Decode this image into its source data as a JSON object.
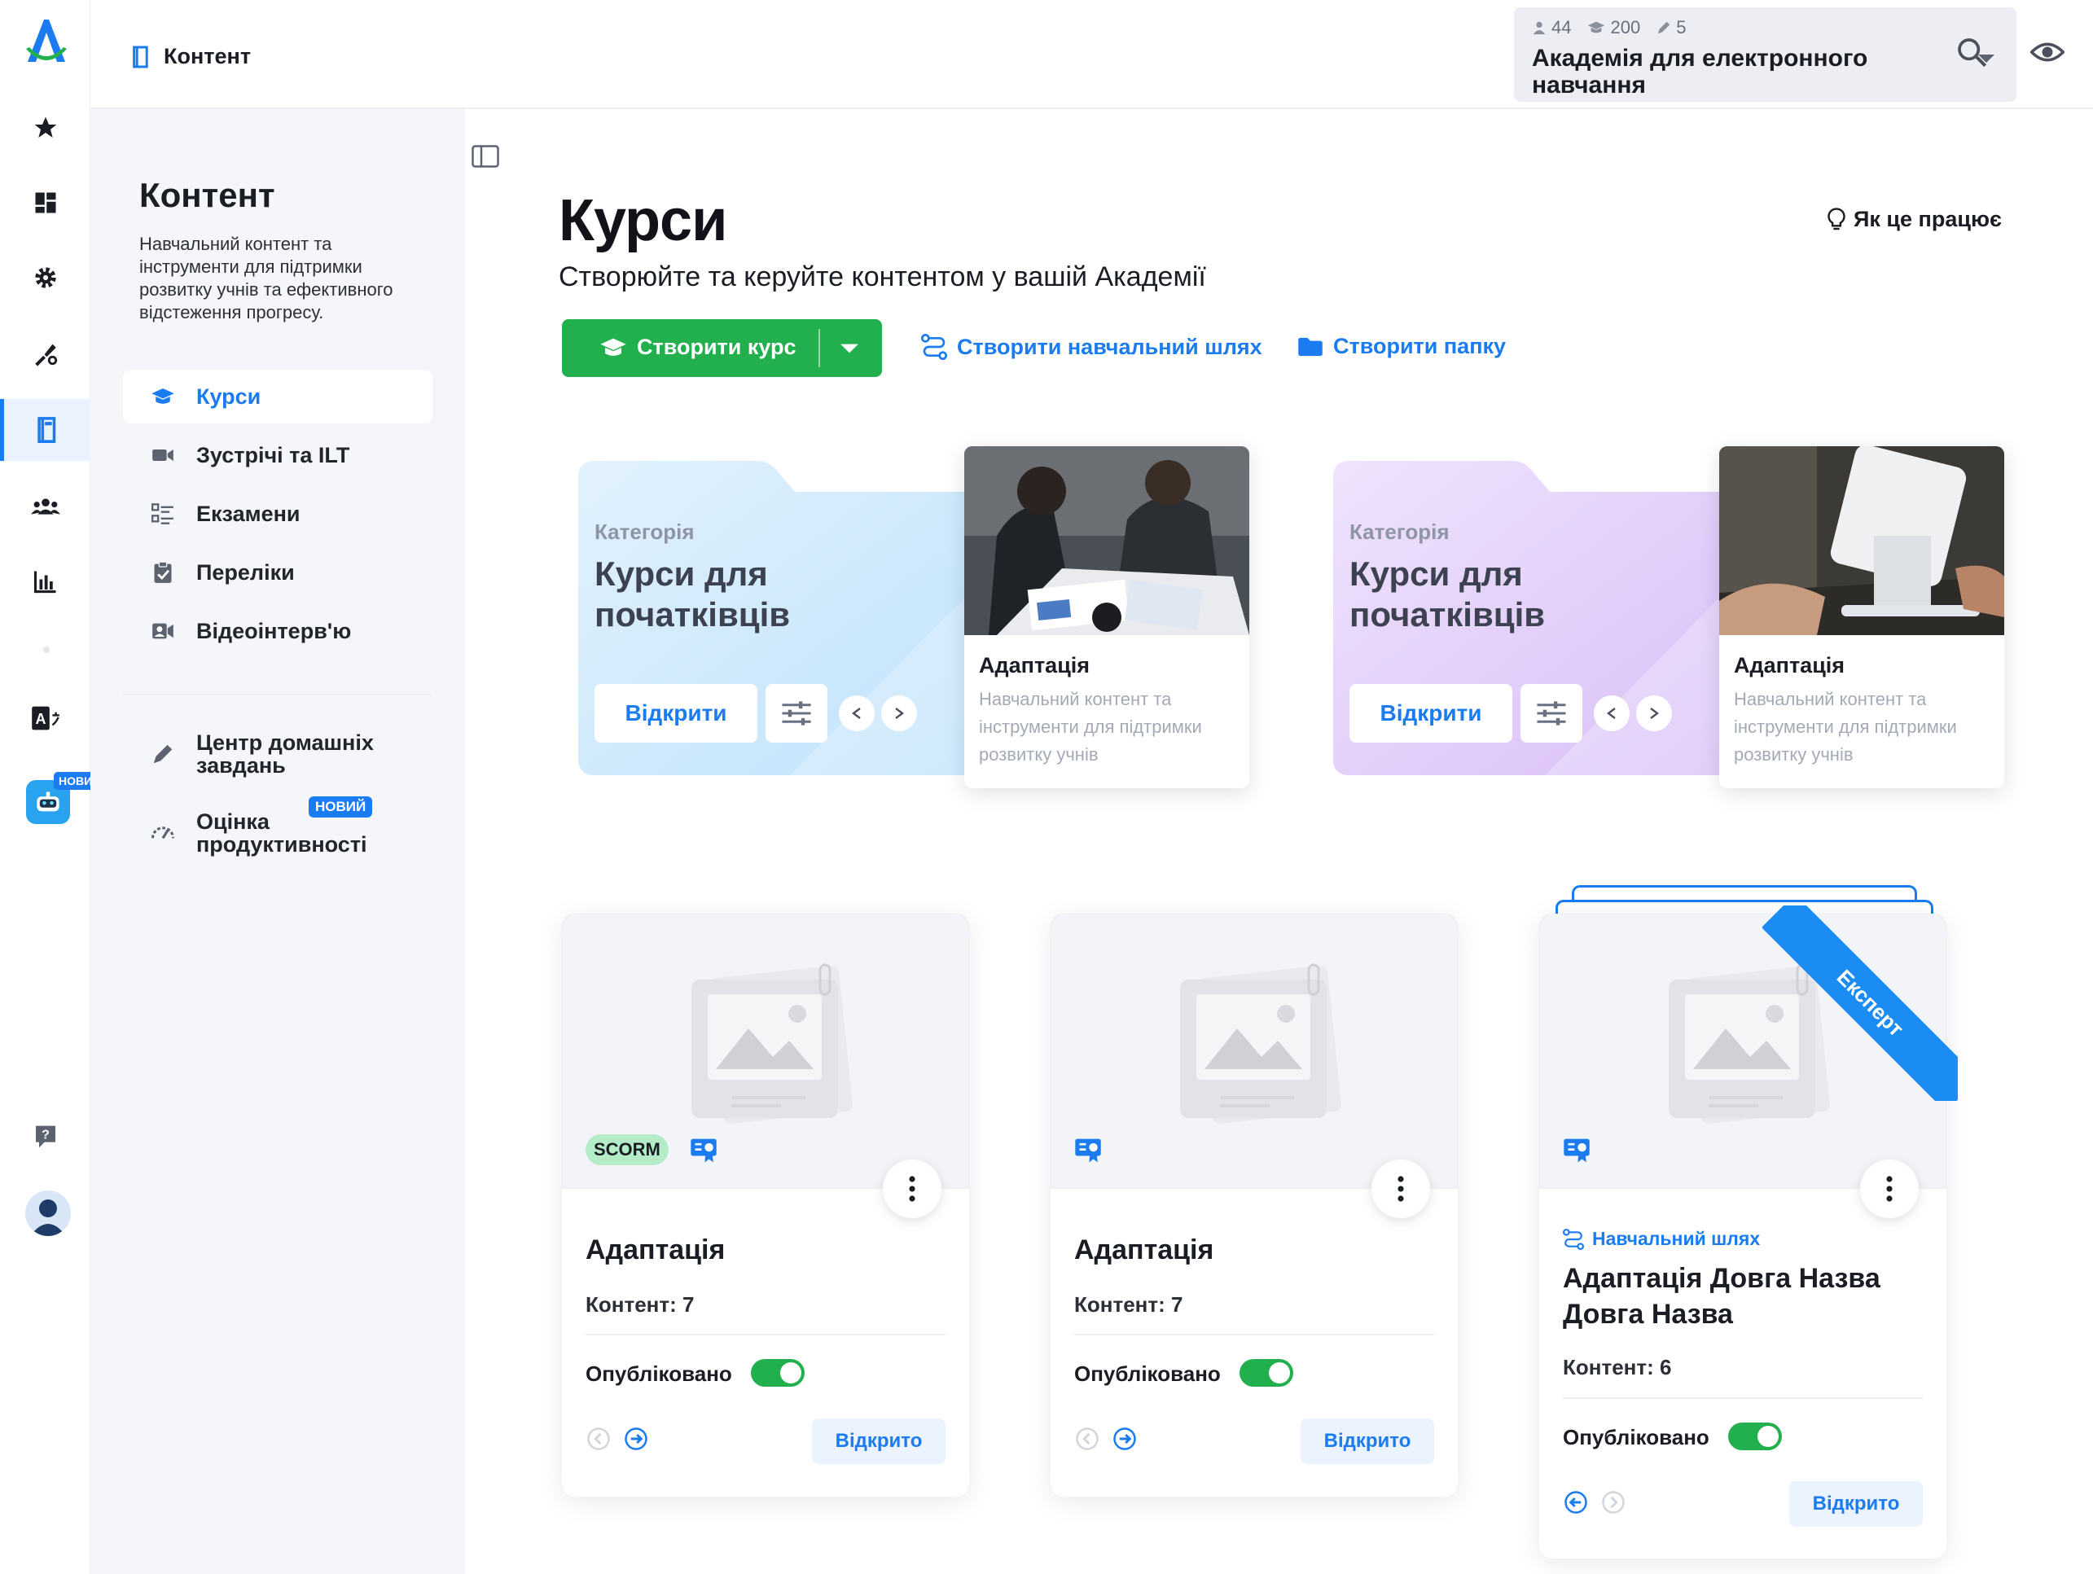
{
  "header": {
    "breadcrumb": "Контент",
    "stats": {
      "users": "44",
      "courses": "200",
      "authors": "5"
    },
    "academy_name": "Академія для електронного навчання"
  },
  "rail": {
    "new_badge": "НОВИЙ",
    "accent": "#1a7cf0"
  },
  "sidebar": {
    "title": "Контент",
    "description": "Навчальний контент та інструменти для підтримки розвитку учнів та ефективного відстеження прогресу.",
    "items": [
      {
        "label": "Курси",
        "icon": "graduation-cap-icon",
        "active": true
      },
      {
        "label": "Зустрічі та ILT",
        "icon": "video-camera-icon"
      },
      {
        "label": "Екзамени",
        "icon": "checklist-icon"
      },
      {
        "label": "Переліки",
        "icon": "clipboard-check-icon"
      },
      {
        "label": "Відеоінтерв'ю",
        "icon": "video-interview-icon"
      }
    ],
    "extra": [
      {
        "label": "Центр домашніх завдань",
        "icon": "pencil-icon"
      },
      {
        "label": "Оцінка продуктивності",
        "icon": "gauge-icon",
        "badge": "НОВИЙ"
      }
    ]
  },
  "main": {
    "title": "Курси",
    "subtitle": "Створюйте та керуйте контентом у вашій Академії",
    "how_it_works": "Як це працює",
    "create_course": "Створити курс",
    "create_path": "Створити навчальний шлях",
    "create_folder": "Створити папку",
    "categories": [
      {
        "kicker": "Категорія",
        "title": "Курси для початківців",
        "open": "Відкрити",
        "preview_title": "Адаптація",
        "preview_desc": "Навчальний контент та інструменти для підтримки розвитку учнів",
        "color": "#d6ecfc"
      },
      {
        "kicker": "Категорія",
        "title": "Курси для початківців",
        "open": "Відкрити",
        "preview_title": "Адаптація",
        "preview_desc": "Навчальний контент та інструменти для підтримки розвитку учнів",
        "color": "#ead9fb"
      }
    ],
    "courses": [
      {
        "badge": "SCORM",
        "title": "Адаптація",
        "content": "Контент: 7",
        "status": "Опубліковано",
        "open": "Відкрито"
      },
      {
        "title": "Адаптація",
        "content": "Контент: 7",
        "status": "Опубліковано",
        "open": "Відкрито"
      },
      {
        "ribbon": "Експерт",
        "kicker": "Навчальний шлях",
        "title": "Адаптація Довга Назва Довга Назва",
        "content": "Контент: 6",
        "status": "Опубліковано",
        "open": "Відкрито"
      }
    ],
    "primary_color": "#22b04f"
  }
}
